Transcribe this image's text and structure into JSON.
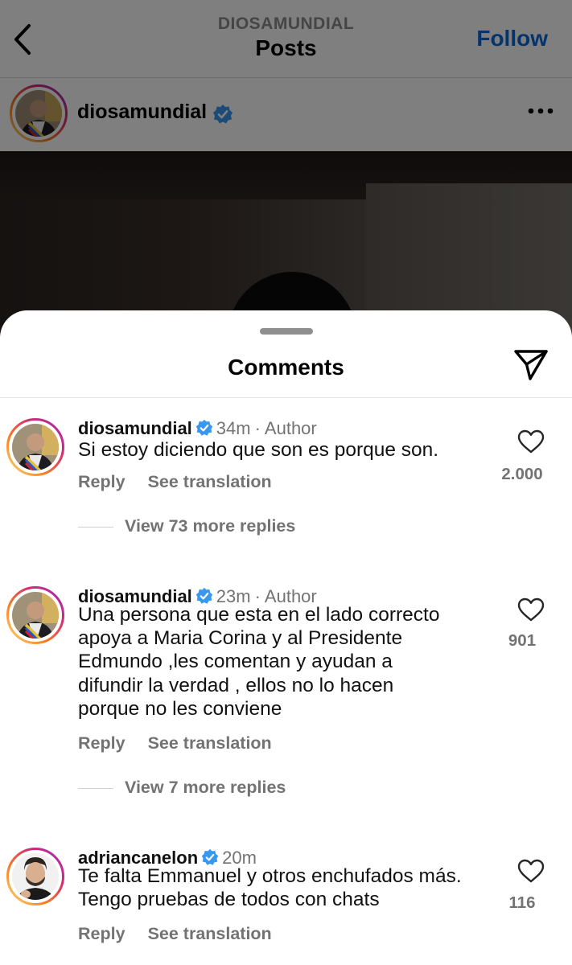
{
  "topbar": {
    "account": "DIOSAMUNDIAL",
    "title": "Posts",
    "follow_label": "Follow"
  },
  "post": {
    "username": "diosamundial",
    "verified": true
  },
  "sheet": {
    "title": "Comments"
  },
  "comments": [
    {
      "username": "diosamundial",
      "time": "34m",
      "badge": "Author",
      "lines": [
        "Si estoy diciendo que son es porque son."
      ],
      "likes": "2.000",
      "reply_label": "Reply",
      "translate_label": "See translation",
      "view_replies": "View 73 more replies"
    },
    {
      "username": "diosamundial",
      "time": "23m",
      "badge": "Author",
      "lines": [
        "Una persona que esta en el lado correcto",
        "apoya a Maria Corina y al Presidente",
        "Edmundo ,les comentan y ayudan a",
        "difundir la verdad , ellos no lo hacen",
        "porque no les conviene"
      ],
      "likes": "901",
      "reply_label": "Reply",
      "translate_label": "See translation",
      "view_replies": "View 7 more replies"
    },
    {
      "username": "adriancanelon",
      "time": "20m",
      "badge": "",
      "lines": [
        "Te falta Emmanuel y otros enchufados más.",
        "Tengo pruebas de todos con chats"
      ],
      "likes": "116",
      "reply_label": "Reply",
      "translate_label": "See translation",
      "view_replies": ""
    }
  ],
  "colors": {
    "follow": "#0a66d8",
    "verified": "#3897f0",
    "secondary_text": "#737373",
    "story_ring": [
      "#feda75",
      "#fa7e1e",
      "#d62976",
      "#962fbf"
    ]
  }
}
